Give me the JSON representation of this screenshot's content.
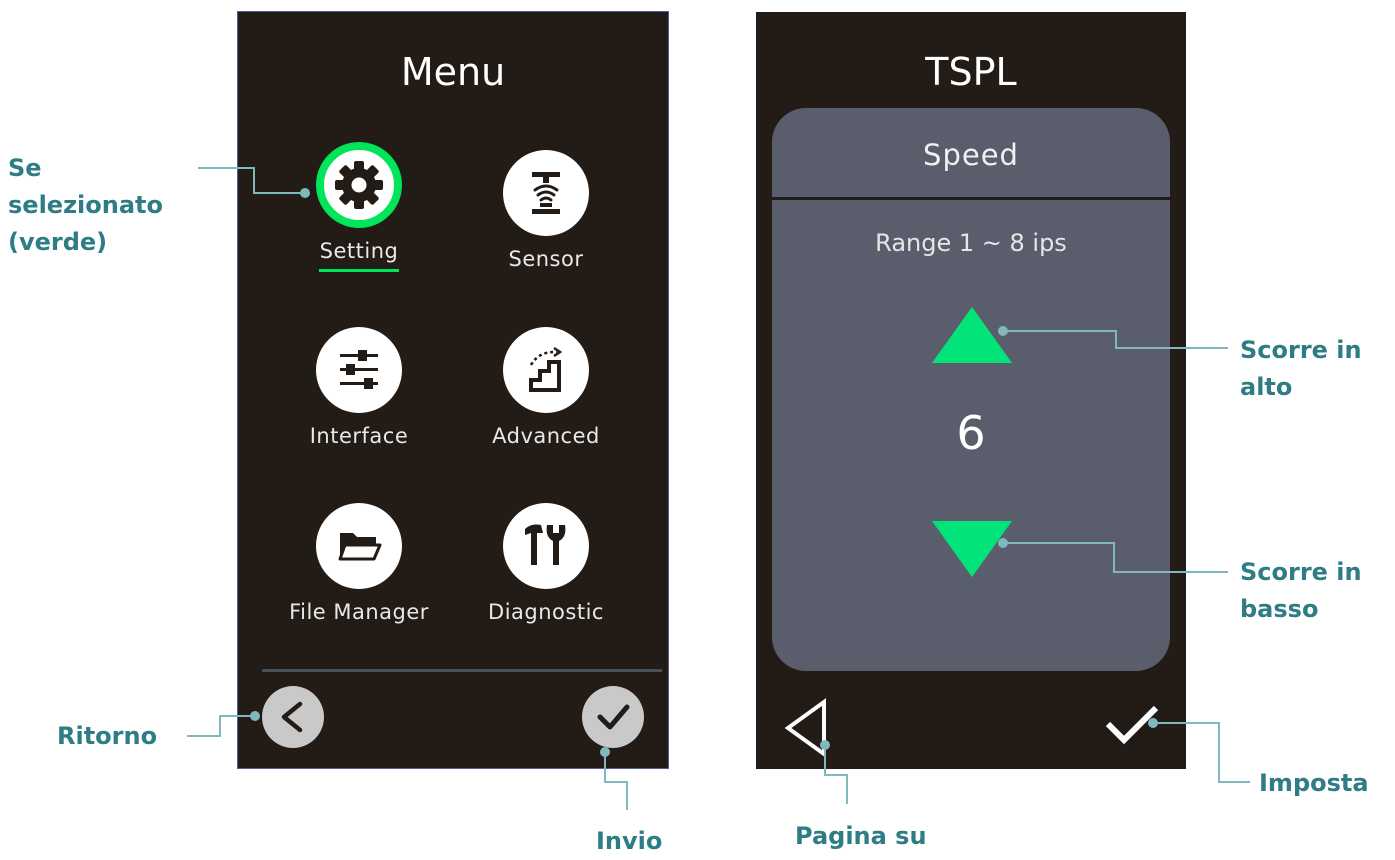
{
  "menu_screen": {
    "title": "Menu",
    "items": [
      {
        "label": "Setting",
        "icon": "gear-icon",
        "selected": true
      },
      {
        "label": "Sensor",
        "icon": "sensor-icon",
        "selected": false
      },
      {
        "label": "Interface",
        "icon": "sliders-icon",
        "selected": false
      },
      {
        "label": "Advanced",
        "icon": "stairs-icon",
        "selected": false
      },
      {
        "label": "File Manager",
        "icon": "folder-icon",
        "selected": false
      },
      {
        "label": "Diagnostic",
        "icon": "tools-icon",
        "selected": false
      }
    ],
    "back_icon": "chevron-left-icon",
    "enter_icon": "checkmark-icon"
  },
  "tspl_screen": {
    "title": "TSPL",
    "panel_title": "Speed",
    "range_text": "Range 1 ~ 8 ips",
    "value": "6",
    "up_icon": "triangle-up-icon",
    "down_icon": "triangle-down-icon",
    "page_up_icon": "triangle-left-outline-icon",
    "set_icon": "checkmark-icon"
  },
  "callouts": {
    "selected_line1": "Se",
    "selected_line2": "selezionato",
    "selected_line3": "(verde)",
    "return": "Ritorno",
    "enter": "Invio",
    "page_up": "Pagina su",
    "scroll_up_line1": "Scorre in",
    "scroll_up_line2": "alto",
    "scroll_down_line1": "Scorre in",
    "scroll_down_line2": "basso",
    "set": "Imposta"
  },
  "colors": {
    "screen_bg": "#231b15",
    "panel_bg": "#5a5e6c",
    "selection_green": "#00e55a",
    "callout_teal": "#2e7c84",
    "leader_line": "#7fb9bd"
  }
}
